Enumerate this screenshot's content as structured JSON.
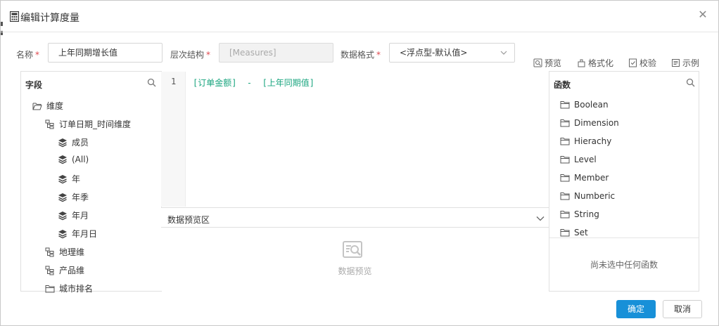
{
  "dialog": {
    "title": "编辑计算度量",
    "close_label": "✕"
  },
  "form": {
    "name_label": "名称",
    "name_value": "上年同期增长值",
    "hierarchy_label": "层次结构",
    "hierarchy_value": "[Measures]",
    "format_label": "数据格式",
    "format_value": "<浮点型-默认值>",
    "required_mark": "*"
  },
  "toolbar": {
    "preview_label": "预览",
    "format_label": "格式化",
    "validate_label": "校验",
    "example_label": "示例"
  },
  "fields_panel": {
    "title": "字段",
    "items": [
      {
        "label": "维度"
      },
      {
        "label": "订单日期_时间维度"
      },
      {
        "label": "成员"
      },
      {
        "label": "(All)"
      },
      {
        "label": "年"
      },
      {
        "label": "年季"
      },
      {
        "label": "年月"
      },
      {
        "label": "年月日"
      },
      {
        "label": "地理维"
      },
      {
        "label": "产品维"
      },
      {
        "label": "城市排名"
      }
    ]
  },
  "editor": {
    "line_number": "1",
    "code": "[订单金额]  -  [上年同期值]"
  },
  "preview": {
    "title": "数据预览区",
    "placeholder": "数据预览"
  },
  "functions_panel": {
    "title": "函数",
    "items": [
      {
        "label": "Boolean"
      },
      {
        "label": "Dimension"
      },
      {
        "label": "Hierachy"
      },
      {
        "label": "Level"
      },
      {
        "label": "Member"
      },
      {
        "label": "Numberic"
      },
      {
        "label": "String"
      },
      {
        "label": "Set"
      }
    ],
    "empty_text": "尚未选中任何函数"
  },
  "footer": {
    "ok_label": "确定",
    "cancel_label": "取消"
  },
  "colors": {
    "accent": "#1890d8",
    "code": "#1aa57f",
    "required": "#e0484e"
  }
}
